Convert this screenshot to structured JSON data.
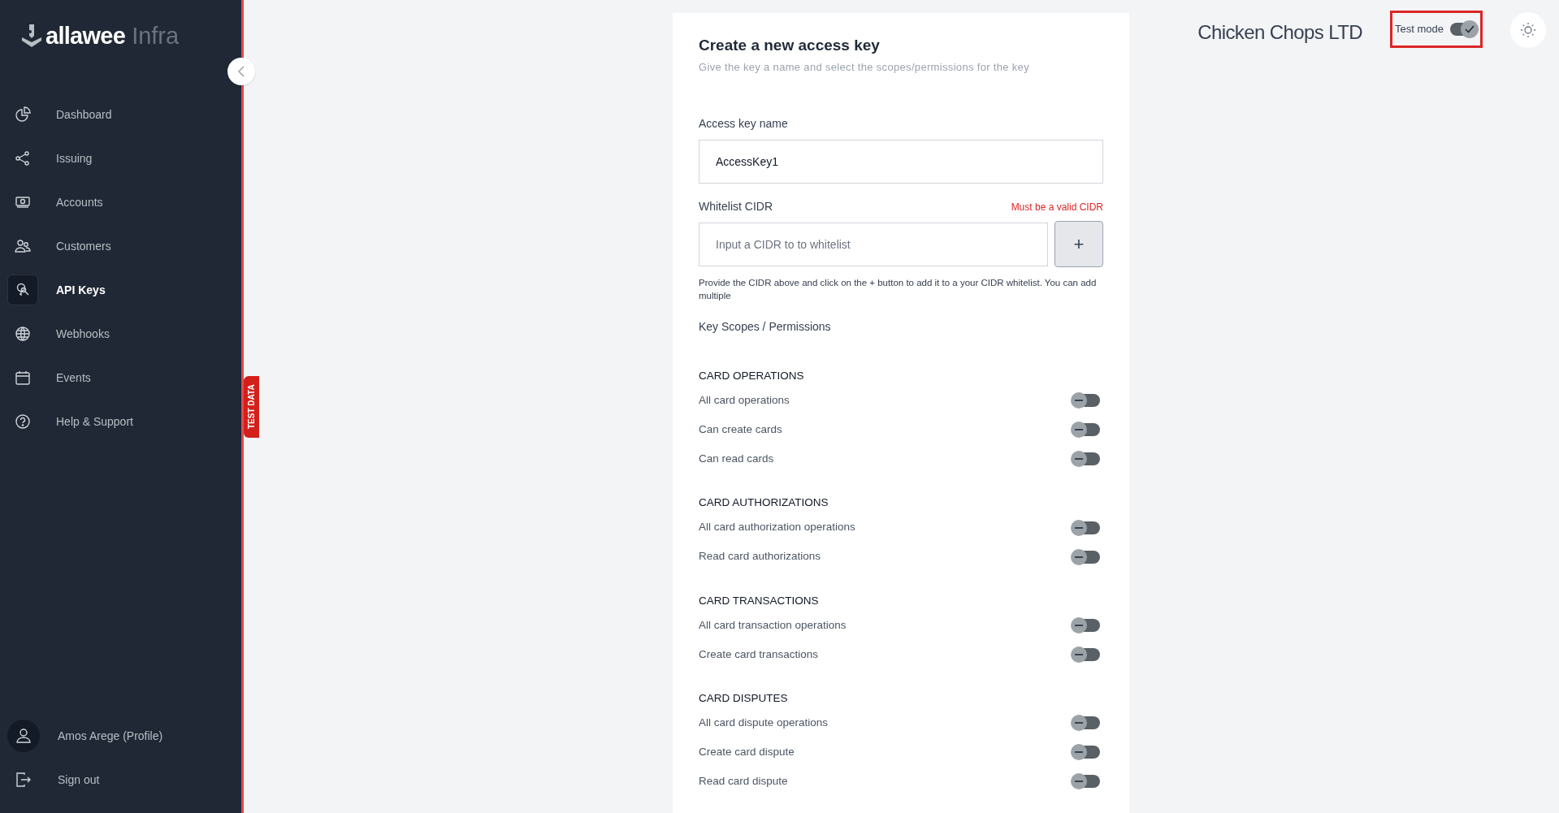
{
  "brand": {
    "name": "allawee",
    "suffix": "Infra"
  },
  "sidebar": {
    "items": [
      {
        "label": "Dashboard",
        "selected": false
      },
      {
        "label": "Issuing",
        "selected": false
      },
      {
        "label": "Accounts",
        "selected": false
      },
      {
        "label": "Customers",
        "selected": false
      },
      {
        "label": "API Keys",
        "selected": true
      },
      {
        "label": "Webhooks",
        "selected": false
      },
      {
        "label": "Events",
        "selected": false
      },
      {
        "label": "Help & Support",
        "selected": false
      }
    ],
    "profile": "Amos Arege (Profile)",
    "sign_out": "Sign out"
  },
  "test_data_tab": "TEST DATA",
  "header": {
    "company": "Chicken Chops LTD",
    "test_mode": {
      "label": "Test mode",
      "on": true
    }
  },
  "form": {
    "title": "Create a new access key",
    "subtitle": "Give the key a name and select the scopes/permissions for the key",
    "name_field": {
      "label": "Access key name",
      "value": "AccessKey1"
    },
    "cidr_field": {
      "label": "Whitelist CIDR",
      "error": "Must be a valid CIDR",
      "placeholder": "Input a CIDR to to whitelist",
      "add_button": "+",
      "help": "Provide the CIDR above and click on the + button to add it to a your CIDR whitelist. You can add multiple"
    },
    "scopes_label": "Key Scopes / Permissions",
    "sections": [
      {
        "title": "CARD OPERATIONS",
        "scopes": [
          {
            "label": "All card operations",
            "on": false
          },
          {
            "label": "Can create cards",
            "on": false
          },
          {
            "label": "Can read cards",
            "on": false
          }
        ]
      },
      {
        "title": "CARD AUTHORIZATIONS",
        "scopes": [
          {
            "label": "All card authorization operations",
            "on": false
          },
          {
            "label": "Read card authorizations",
            "on": false
          }
        ]
      },
      {
        "title": "CARD TRANSACTIONS",
        "scopes": [
          {
            "label": "All card transaction operations",
            "on": false
          },
          {
            "label": "Create card transactions",
            "on": false
          }
        ]
      },
      {
        "title": "CARD DISPUTES",
        "scopes": [
          {
            "label": "All card dispute operations",
            "on": false
          },
          {
            "label": "Create card dispute",
            "on": false
          },
          {
            "label": "Read card dispute",
            "on": false
          }
        ]
      }
    ]
  }
}
